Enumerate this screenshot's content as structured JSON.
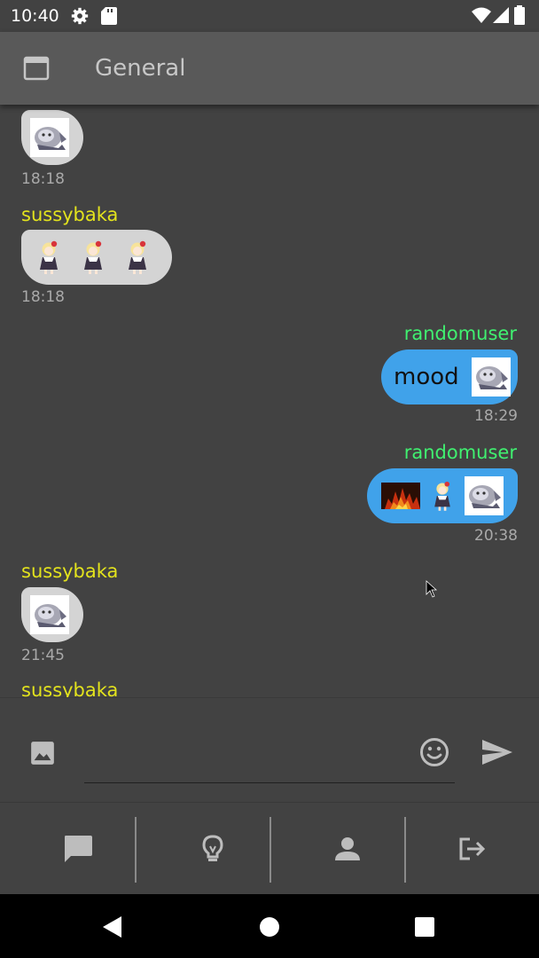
{
  "status_bar": {
    "time": "10:40",
    "icons": [
      "settings-icon",
      "sd-card-icon",
      "wifi-icon",
      "signal-icon",
      "battery-icon"
    ]
  },
  "app_bar": {
    "title": "General",
    "menu_icon": "window-icon"
  },
  "messages": [
    {
      "sender": "",
      "own": false,
      "time": "18:18",
      "text": "",
      "stickers": [
        "sticker-gray-character"
      ]
    },
    {
      "sender": "sussybaka",
      "own": false,
      "time": "18:18",
      "text": "",
      "stickers": [
        "sticker-blonde-girl",
        "sticker-blonde-girl",
        "sticker-blonde-girl"
      ]
    },
    {
      "sender": "randomuser",
      "own": true,
      "time": "18:29",
      "text": "mood",
      "stickers": [
        "sticker-gray-character"
      ]
    },
    {
      "sender": "randomuser",
      "own": true,
      "time": "20:38",
      "text": "",
      "stickers": [
        "sticker-fire",
        "sticker-blonde-girl",
        "sticker-gray-character"
      ]
    },
    {
      "sender": "sussybaka",
      "own": false,
      "time": "21:45",
      "text": "",
      "stickers": [
        "sticker-gray-character"
      ]
    },
    {
      "sender": "sussybaka",
      "own": false,
      "time": "",
      "text": "",
      "stickers": []
    }
  ],
  "input_bar": {
    "image_icon": "image-icon",
    "emoji_icon": "emoji-icon",
    "send_icon": "send-icon",
    "value": "",
    "placeholder": ""
  },
  "bottom_nav": {
    "items": [
      "chat-icon",
      "lightbulb-icon",
      "person-icon",
      "logout-icon"
    ]
  },
  "system_nav": [
    "back-icon",
    "home-icon",
    "recents-icon"
  ],
  "colors": {
    "background": "#424242",
    "app_bar": "#595959",
    "own_bubble": "#40a2ea",
    "other_bubble": "#d4d4d4",
    "own_name": "#40f070",
    "other_name": "#e3e31d"
  }
}
